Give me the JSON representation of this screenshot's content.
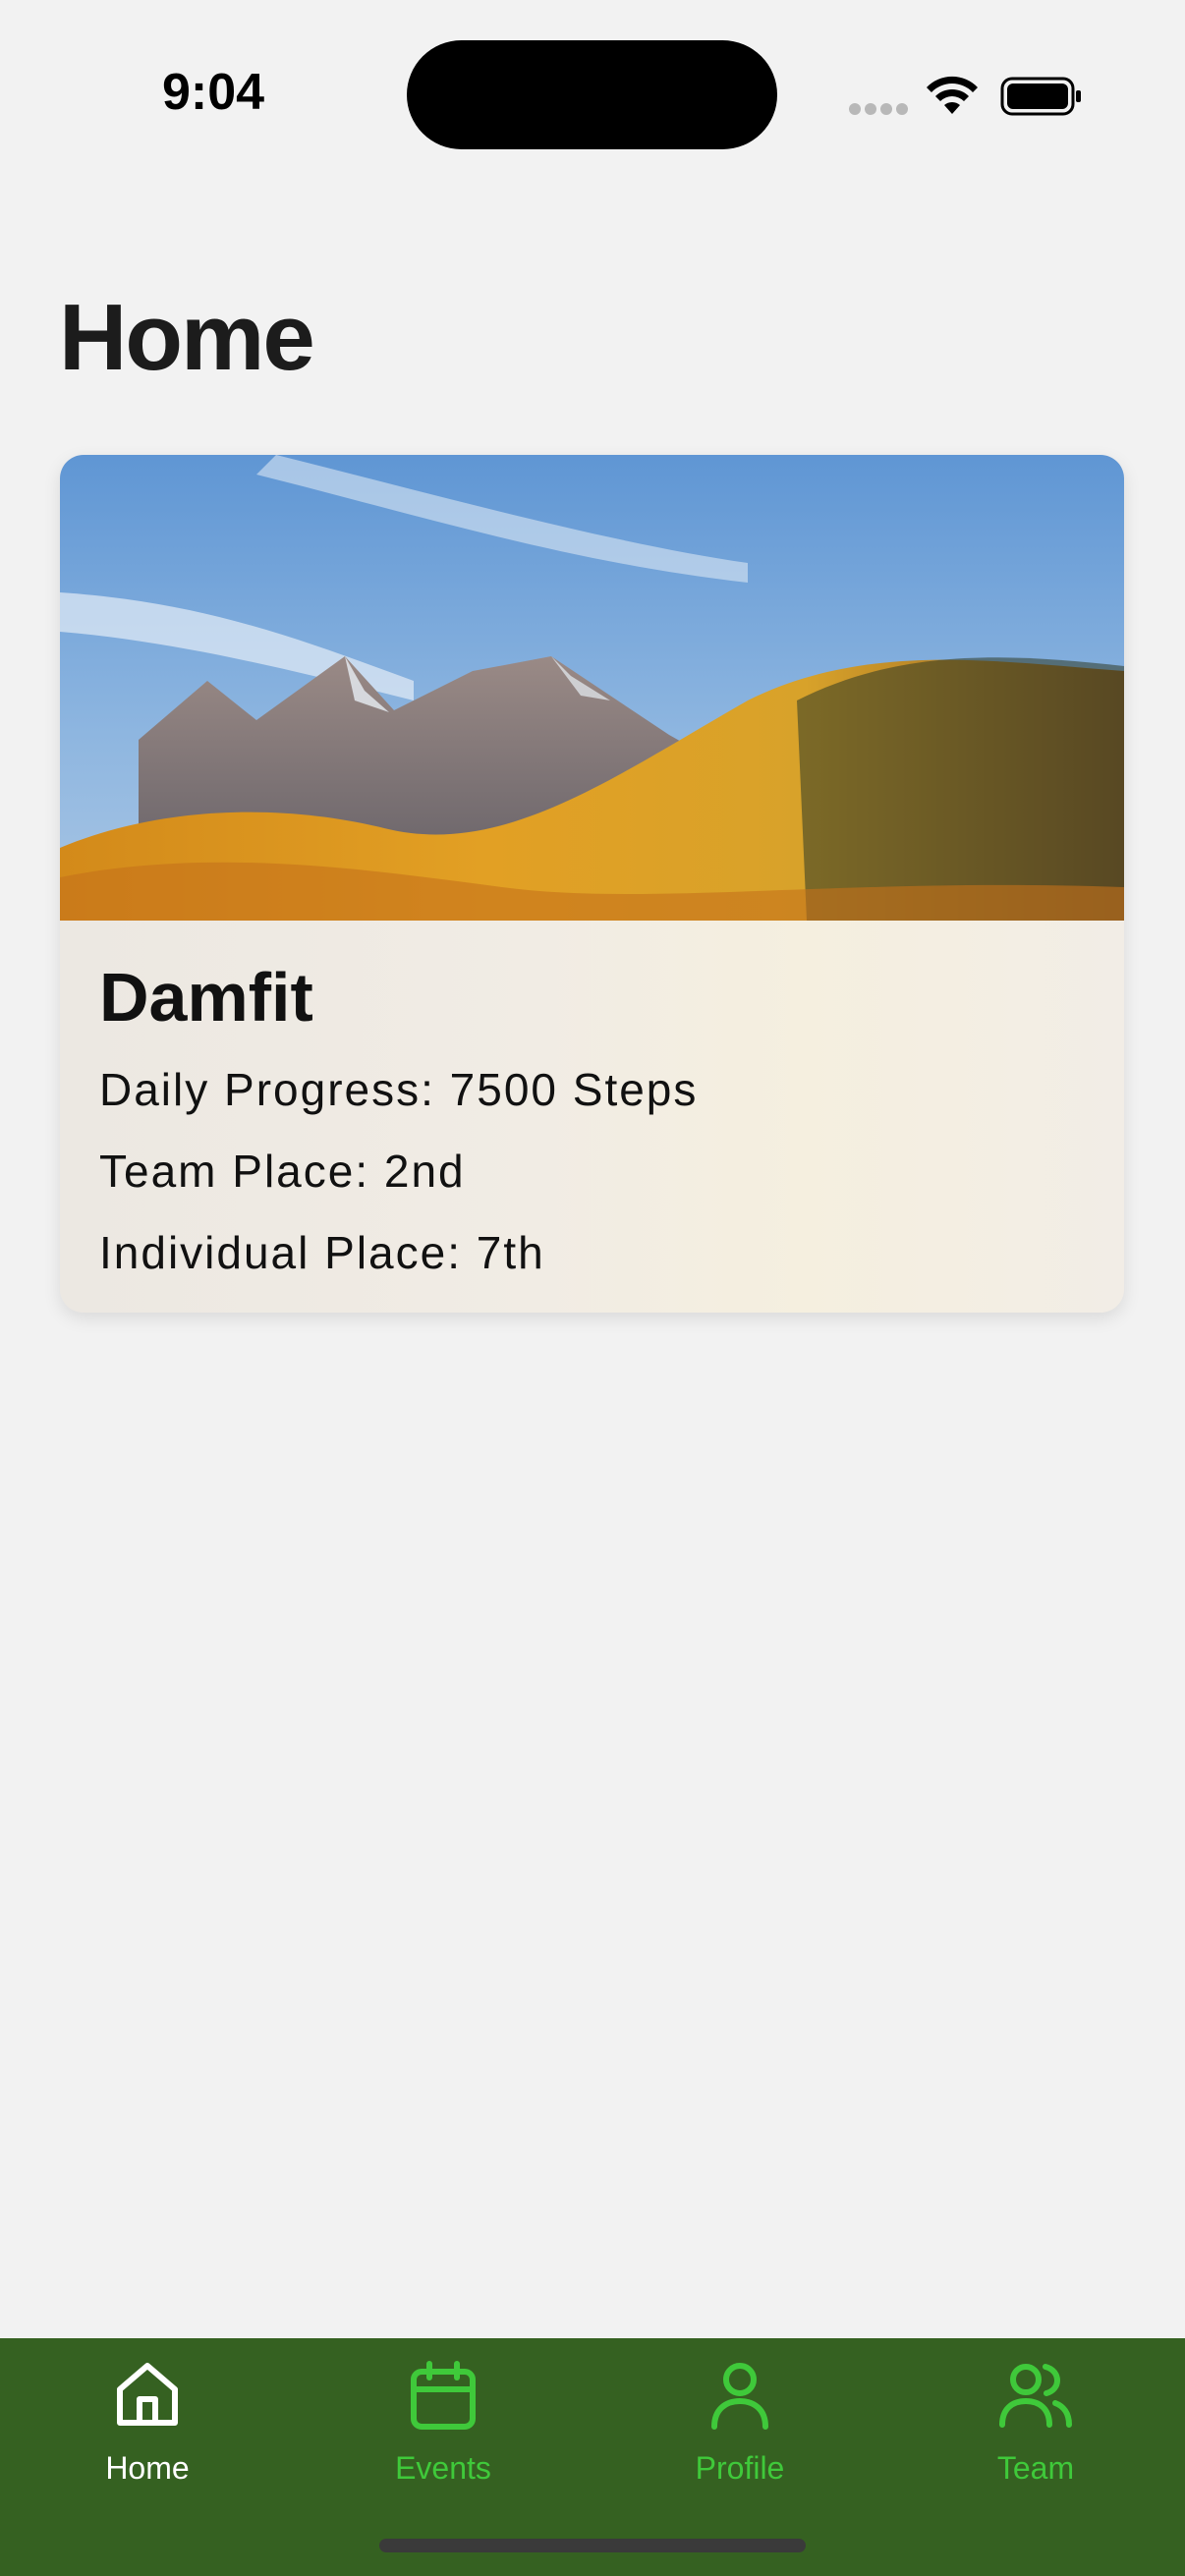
{
  "status_bar": {
    "time": "9:04",
    "icons": [
      "cellular-signal-icon",
      "wifi-icon",
      "battery-icon"
    ]
  },
  "page": {
    "title": "Home"
  },
  "card": {
    "image_description_icon": "mountain-landscape-image",
    "title": "Damfit",
    "daily_progress": "Daily Progress: 7500 Steps",
    "team_place": "Team Place: 2nd",
    "individual_place": "Individual Place: 7th"
  },
  "tab_bar": {
    "background_color": "#356121",
    "active_color": "#ffffff",
    "inactive_color": "#3fc93a",
    "tabs": [
      {
        "label": "Home",
        "icon": "home-icon",
        "active": true
      },
      {
        "label": "Events",
        "icon": "calendar-icon",
        "active": false
      },
      {
        "label": "Profile",
        "icon": "person-icon",
        "active": false
      },
      {
        "label": "Team",
        "icon": "people-icon",
        "active": false
      }
    ]
  }
}
